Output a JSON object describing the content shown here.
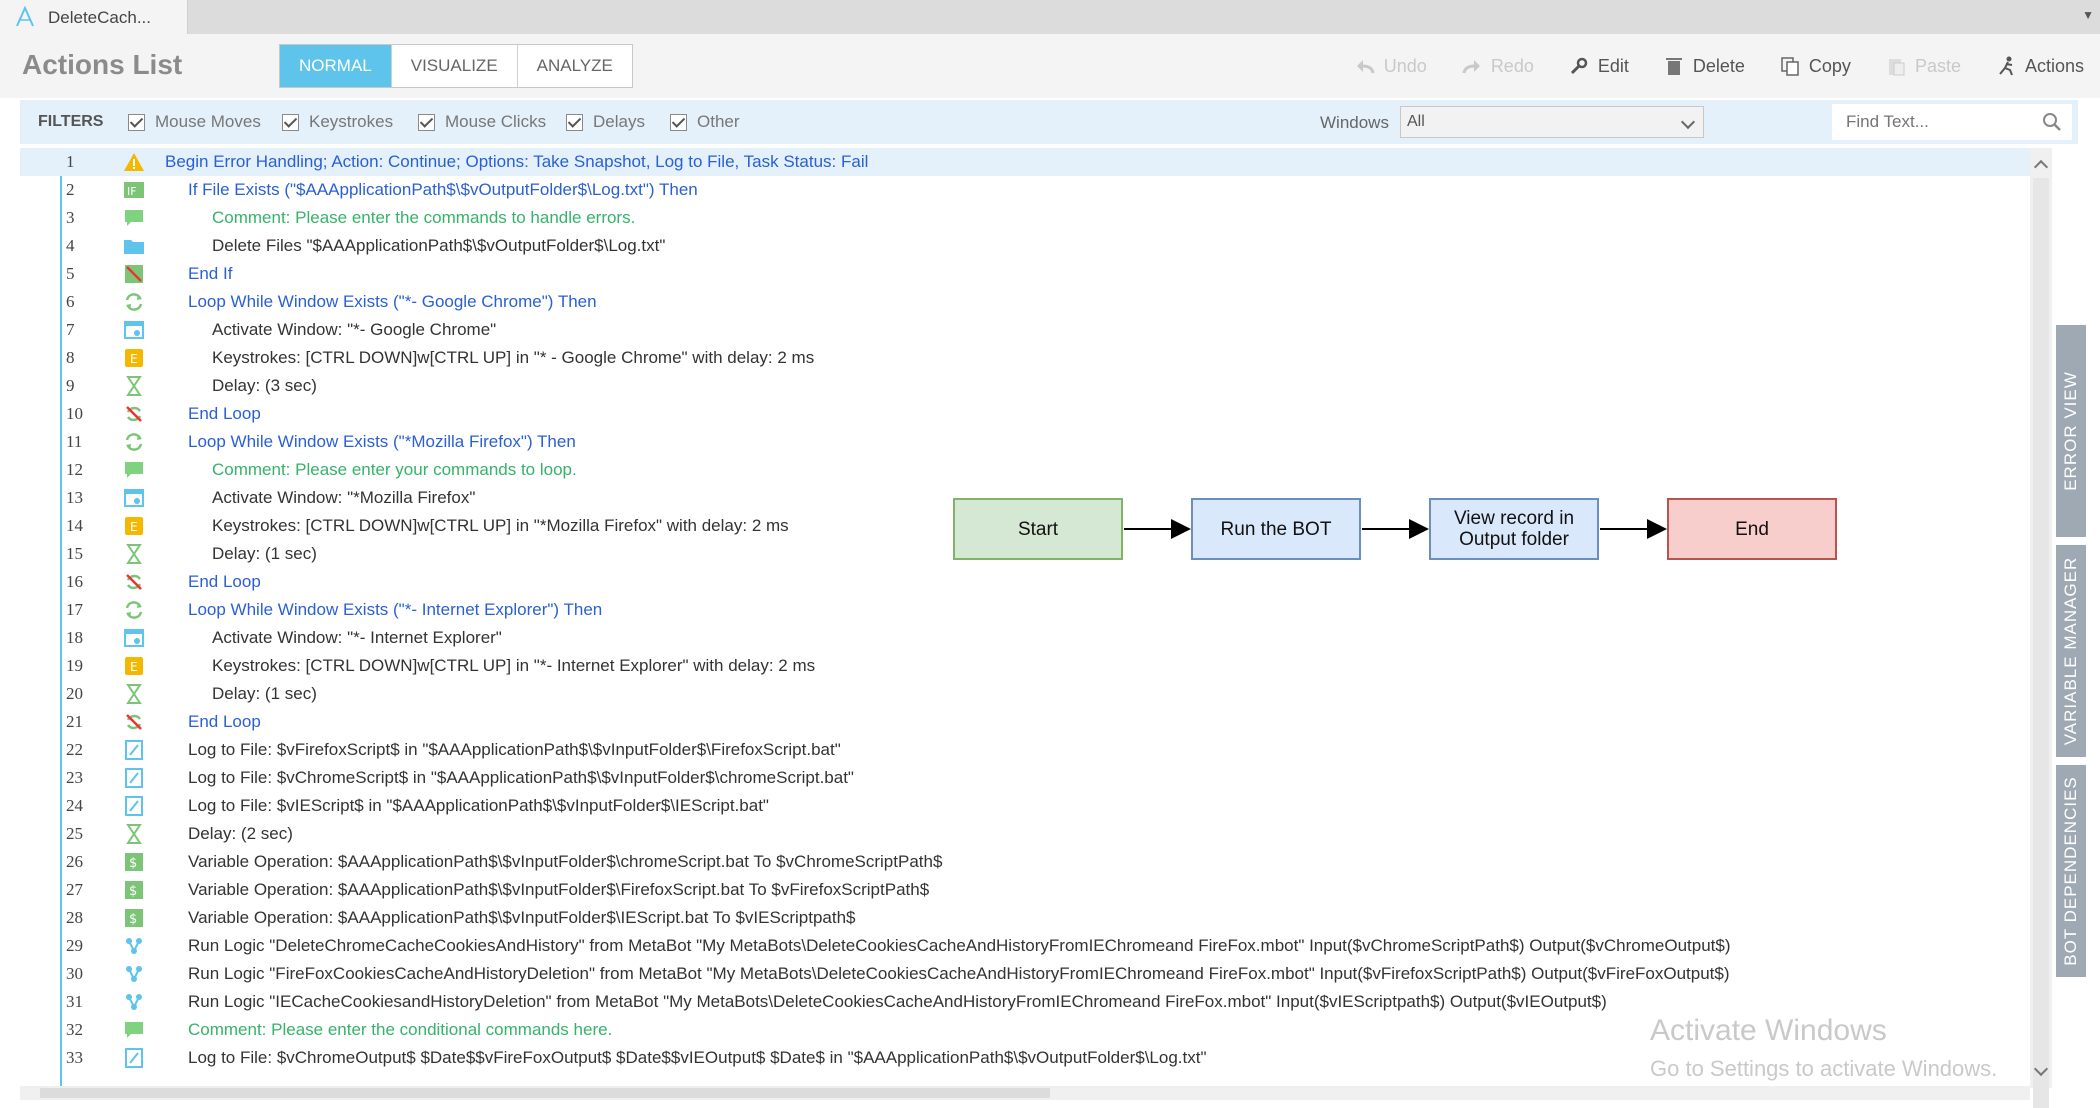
{
  "tab": {
    "title": "DeleteCach..."
  },
  "header": {
    "title": "Actions List",
    "modes": [
      "NORMAL",
      "VISUALIZE",
      "ANALYZE"
    ],
    "tools": {
      "undo": "Undo",
      "redo": "Redo",
      "edit": "Edit",
      "delete": "Delete",
      "copy": "Copy",
      "paste": "Paste",
      "actions": "Actions"
    }
  },
  "filters": {
    "label": "FILTERS",
    "items": [
      "Mouse Moves",
      "Keystrokes",
      "Mouse Clicks",
      "Delays",
      "Other"
    ],
    "windows_label": "Windows",
    "windows_value": "All",
    "find_placeholder": "Find Text..."
  },
  "rows": [
    {
      "n": "1",
      "text": "Begin Error Handling; Action: Continue; Options: Take Snapshot, Log to File,  Task Status: Fail",
      "icon": "warning-icon"
    },
    {
      "n": "2",
      "text": "If File Exists (\"$AAApplicationPath$\\$vOutputFolder$\\Log.txt\")  Then",
      "icon": "if-icon"
    },
    {
      "n": "3",
      "text": "Comment: Please enter the commands to handle errors.",
      "icon": "comment-icon"
    },
    {
      "n": "4",
      "text": "Delete Files \"$AAApplicationPath$\\$vOutputFolder$\\Log.txt\"",
      "icon": "folder-icon"
    },
    {
      "n": "5",
      "text": "End If",
      "icon": "end-if-icon"
    },
    {
      "n": "6",
      "text": "Loop While Window Exists (\"*- Google Chrome\")  Then",
      "icon": "loop-icon"
    },
    {
      "n": "7",
      "text": "Activate Window: \"*- Google Chrome\"",
      "icon": "window-icon"
    },
    {
      "n": "8",
      "text": "Keystrokes: [CTRL DOWN]w[CTRL UP] in \"* - Google Chrome\" with delay: 2 ms",
      "icon": "keystroke-icon"
    },
    {
      "n": "9",
      "text": "Delay: (3 sec)",
      "icon": "hourglass-icon"
    },
    {
      "n": "10",
      "text": "End Loop",
      "icon": "end-loop-icon"
    },
    {
      "n": "11",
      "text": "Loop While Window Exists (\"*Mozilla Firefox\")  Then",
      "icon": "loop-icon"
    },
    {
      "n": "12",
      "text": "Comment: Please enter your commands to loop.",
      "icon": "comment-icon"
    },
    {
      "n": "13",
      "text": "Activate Window: \"*Mozilla Firefox\"",
      "icon": "window-icon"
    },
    {
      "n": "14",
      "text": "Keystrokes: [CTRL DOWN]w[CTRL UP] in \"*Mozilla Firefox\" with delay: 2 ms",
      "icon": "keystroke-icon"
    },
    {
      "n": "15",
      "text": "Delay: (1 sec)",
      "icon": "hourglass-icon"
    },
    {
      "n": "16",
      "text": "End Loop",
      "icon": "end-loop-icon"
    },
    {
      "n": "17",
      "text": "Loop While Window Exists (\"*- Internet Explorer\")  Then",
      "icon": "loop-icon"
    },
    {
      "n": "18",
      "text": "Activate Window: \"*- Internet Explorer\"",
      "icon": "window-icon"
    },
    {
      "n": "19",
      "text": "Keystrokes: [CTRL DOWN]w[CTRL UP] in \"*- Internet Explorer\" with delay: 2 ms",
      "icon": "keystroke-icon"
    },
    {
      "n": "20",
      "text": "Delay: (1 sec)",
      "icon": "hourglass-icon"
    },
    {
      "n": "21",
      "text": "End Loop",
      "icon": "end-loop-icon"
    },
    {
      "n": "22",
      "text": "Log to File: $vFirefoxScript$ in \"$AAApplicationPath$\\$vInputFolder$\\FirefoxScript.bat\"",
      "icon": "log-icon"
    },
    {
      "n": "23",
      "text": "Log to File: $vChromeScript$ in \"$AAApplicationPath$\\$vInputFolder$\\chromeScript.bat\"",
      "icon": "log-icon"
    },
    {
      "n": "24",
      "text": "Log to File: $vIEScript$ in \"$AAApplicationPath$\\$vInputFolder$\\IEScript.bat\"",
      "icon": "log-icon"
    },
    {
      "n": "25",
      "text": "Delay: (2 sec)",
      "icon": "hourglass-icon"
    },
    {
      "n": "26",
      "text": "Variable Operation: $AAApplicationPath$\\$vInputFolder$\\chromeScript.bat To $vChromeScriptPath$",
      "icon": "variable-icon"
    },
    {
      "n": "27",
      "text": "Variable Operation: $AAApplicationPath$\\$vInputFolder$\\FirefoxScript.bat To $vFirefoxScriptPath$",
      "icon": "variable-icon"
    },
    {
      "n": "28",
      "text": "Variable Operation: $AAApplicationPath$\\$vInputFolder$\\IEScript.bat To $vIEScriptpath$",
      "icon": "variable-icon"
    },
    {
      "n": "29",
      "text": "Run Logic \"DeleteChromeCacheCookiesAndHistory\" from MetaBot \"My MetaBots\\DeleteCookiesCacheAndHistoryFromIEChromeand FireFox.mbot\" Input($vChromeScriptPath$) Output($vChromeOutput$)",
      "icon": "metabot-icon"
    },
    {
      "n": "30",
      "text": "Run Logic \"FireFoxCookiesCacheAndHistoryDeletion\" from MetaBot \"My MetaBots\\DeleteCookiesCacheAndHistoryFromIEChromeand FireFox.mbot\" Input($vFirefoxScriptPath$) Output($vFireFoxOutput$)",
      "icon": "metabot-icon"
    },
    {
      "n": "31",
      "text": "Run Logic \"IECacheCookiesandHistoryDeletion\" from MetaBot \"My MetaBots\\DeleteCookiesCacheAndHistoryFromIEChromeand FireFox.mbot\" Input($vIEScriptpath$) Output($vIEOutput$)",
      "icon": "metabot-icon"
    },
    {
      "n": "32",
      "text": "Comment: Please enter the conditional commands here.",
      "icon": "comment-icon"
    },
    {
      "n": "33",
      "text": "Log to File: $vChromeOutput$  $Date$$vFireFoxOutput$  $Date$$vIEOutput$  $Date$ in \"$AAApplicationPath$\\$vOutputFolder$\\Log.txt\"",
      "icon": "log-icon"
    }
  ],
  "flow": {
    "nodes": [
      "Start",
      "Run the BOT",
      "View record in Output folder",
      "End"
    ],
    "colors": {
      "start": "#d5e8d4",
      "start_border": "#82b366",
      "mid": "#dae8fc",
      "mid_border": "#6c8ebf",
      "end": "#f8cecc",
      "end_border": "#b85450"
    }
  },
  "side_tabs": [
    "ERROR VIEW",
    "VARIABLE MANAGER",
    "BOT DEPENDENCIES"
  ],
  "watermark": {
    "line1": "Activate Windows",
    "line2": "Go to Settings to activate Windows."
  },
  "colors": {
    "accent": "#5ec4ec",
    "filter_bg": "#e4f1fa",
    "blue_text": "#2a5fd6",
    "green_text": "#36b36a"
  }
}
